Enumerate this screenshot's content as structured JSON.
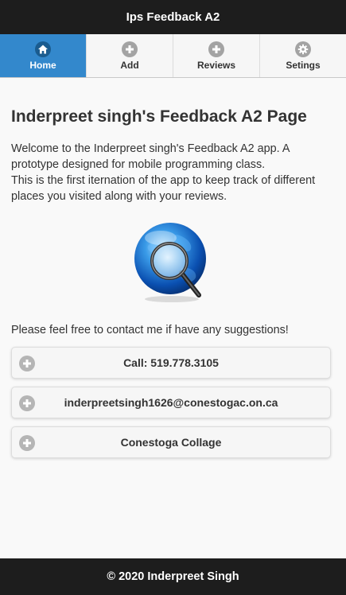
{
  "header": {
    "title": "Ips Feedback A2"
  },
  "navbar": {
    "items": [
      {
        "label": "Home",
        "icon": "home-icon",
        "active": true
      },
      {
        "label": "Add",
        "icon": "plus-icon",
        "active": false
      },
      {
        "label": "Reviews",
        "icon": "plus-icon",
        "active": false
      },
      {
        "label": "Setings",
        "icon": "gear-icon",
        "active": false
      }
    ]
  },
  "main": {
    "title": "Inderpreet singh's Feedback A2 Page",
    "intro_line1": "Welcome to the Inderpreet singh's Feedback A2 app. A prototype designed for mobile programming class.",
    "intro_line2": "This is the first iternation of the app to keep track of different places you visited along with your reviews.",
    "image_icon": "globe-search-icon",
    "contact_text": "Please feel free to contact me if have any suggestions!",
    "buttons": [
      {
        "label": "Call: 519.778.3105",
        "icon": "plus-icon"
      },
      {
        "label": "inderpreetsingh1626@conestogac.on.ca",
        "icon": "plus-icon"
      },
      {
        "label": "Conestoga Collage",
        "icon": "plus-icon"
      }
    ]
  },
  "footer": {
    "text": "© 2020 Inderpreet Singh"
  },
  "colors": {
    "bar_bg": "#1d1d1d",
    "active_tab": "#3388cc",
    "page_bg": "#f9f9f9"
  }
}
